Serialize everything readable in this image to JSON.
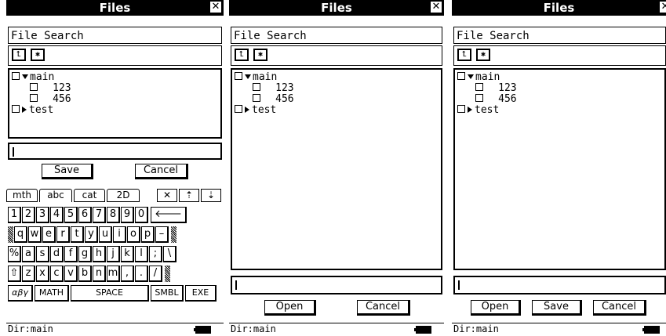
{
  "panels": [
    {
      "title": "Files",
      "close_icon": "✕",
      "menu": "File Search",
      "tree": {
        "folder1": "main",
        "file1": "123",
        "file2": "456",
        "folder2": "test"
      },
      "buttons": [
        "Save",
        "Cancel"
      ],
      "status": "Dir:main"
    },
    {
      "title": "Files",
      "close_icon": "✕",
      "menu": "File Search",
      "tree": {
        "folder1": "main",
        "file1": "123",
        "file2": "456",
        "folder2": "test"
      },
      "buttons": [
        "Open",
        "Cancel"
      ],
      "status": "Dir:main"
    },
    {
      "title": "Files",
      "close_icon": "✕",
      "menu": "File Search",
      "tree": {
        "folder1": "main",
        "file1": "123",
        "file2": "456",
        "folder2": "test"
      },
      "buttons": [
        "Open",
        "Save",
        "Cancel"
      ],
      "status": "Dir:main"
    }
  ],
  "keyboard": {
    "tabs": [
      "mth",
      "abc",
      "cat",
      "2D"
    ],
    "tab_icons": [
      "✕",
      "⇡",
      "⇣"
    ],
    "row1": [
      "1",
      "2",
      "3",
      "4",
      "5",
      "6",
      "7",
      "8",
      "9",
      "0",
      "🡐"
    ],
    "row2": [
      "q",
      "w",
      "e",
      "r",
      "t",
      "y",
      "u",
      "i",
      "o",
      "p",
      "–"
    ],
    "row3": [
      "%",
      "a",
      "s",
      "d",
      "f",
      "g",
      "h",
      "j",
      "k",
      "l",
      ";",
      "\\"
    ],
    "row4": [
      "⇧",
      "z",
      "x",
      "c",
      "v",
      "b",
      "n",
      "m",
      ",",
      ".",
      "/"
    ],
    "row5": [
      "αβγ",
      "MATH",
      "SPACE",
      "SMBL",
      "EXE"
    ]
  },
  "icons": {
    "up_folder": "up-folder-icon",
    "new_folder": "new-folder-icon",
    "battery": "battery-icon"
  }
}
